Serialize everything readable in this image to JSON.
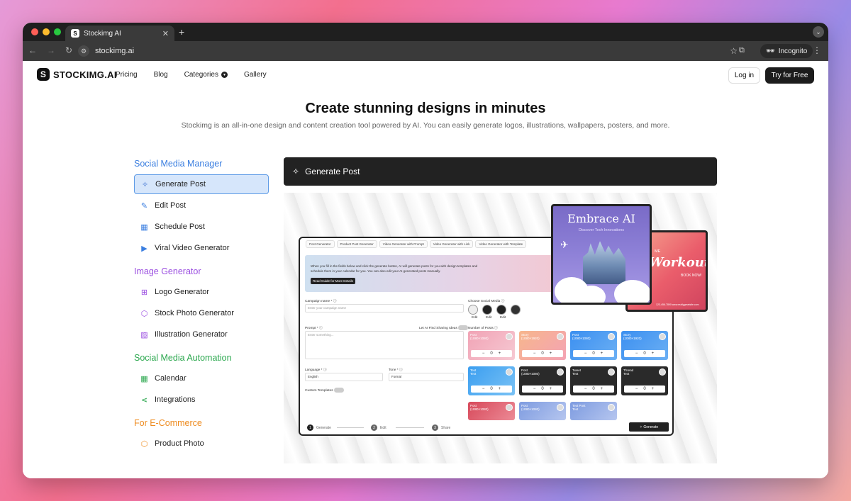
{
  "browser": {
    "tab_title": "Stockimg AI",
    "tab_favicon": "S",
    "url": "stockimg.ai",
    "incognito_label": "Incognito"
  },
  "nav": {
    "logo_text": "STOCKIMG.AI",
    "logo_mark": "S",
    "links": [
      "Pricing",
      "Blog",
      "Categories",
      "Gallery"
    ],
    "login": "Log in",
    "try_free": "Try for Free"
  },
  "hero": {
    "title": "Create stunning designs in minutes",
    "subtitle": "Stockimg is an all-in-one design and content creation tool powered by AI. You can easily generate logos, illustrations, wallpapers, posters, and more."
  },
  "sidebar": {
    "sections": [
      {
        "title": "Social Media Manager",
        "color": "#3a7ee0",
        "items": [
          {
            "label": "Generate Post",
            "icon": "sparkle-icon"
          },
          {
            "label": "Edit Post",
            "icon": "edit-icon"
          },
          {
            "label": "Schedule Post",
            "icon": "calendar-icon"
          },
          {
            "label": "Viral Video Generator",
            "icon": "video-icon"
          }
        ]
      },
      {
        "title": "Image Generator",
        "color": "#9b4fe0",
        "items": [
          {
            "label": "Logo Generator",
            "icon": "grid-icon"
          },
          {
            "label": "Stock Photo Generator",
            "icon": "cube-icon"
          },
          {
            "label": "Illustration Generator",
            "icon": "image-icon"
          }
        ]
      },
      {
        "title": "Social Media Automation",
        "color": "#2ca84f",
        "items": [
          {
            "label": "Calendar",
            "icon": "calendar-icon"
          },
          {
            "label": "Integrations",
            "icon": "share-icon"
          }
        ]
      },
      {
        "title": "For E-Commerce",
        "color": "#ee8b1f",
        "items": [
          {
            "label": "Product Photo",
            "icon": "box-icon"
          }
        ]
      }
    ]
  },
  "demo": {
    "header": "Generate Post",
    "mock": {
      "tabs": [
        "Post Generator",
        "Product Post Generator",
        "Video Generator with Prompt",
        "Video Generator with Link",
        "Video Generator with Template"
      ],
      "banner_text": "When you fill in the fields below and click the generate button, AI will generate posts for you with design templates and schedule them in your calendar for you. You can also edit your AI-generated posts manually.",
      "banner_button": "Read Guide for More Details",
      "campaign_label": "Campaign name * ⓘ",
      "campaign_placeholder": "Enter your campaign name",
      "social_label": "Choose Social Media ⓘ",
      "social_edit": [
        "Edit",
        "Edit",
        "Edit"
      ],
      "prompt_label": "Prompt * ⓘ",
      "prompt_placeholder": "Enter something...",
      "find_ideas": "Let AI Find Sharing Ideas",
      "num_posts_label": "Number of Posts ⓘ",
      "language_label": "Language * ⓘ",
      "language_value": "English",
      "tone_label": "Tone * ⓘ",
      "tone_value": "Formal",
      "custom_templates": "Custom Templates",
      "tiles": [
        {
          "name": "Post",
          "size": "(1080×1080)",
          "count": "0"
        },
        {
          "name": "Story",
          "size": "(1080×1920)",
          "count": "0"
        },
        {
          "name": "Post",
          "size": "(1080×1080)",
          "count": "0"
        },
        {
          "name": "Story",
          "size": "(1080×1920)",
          "count": "0"
        },
        {
          "name": "Text",
          "size": "Text",
          "count": "0"
        },
        {
          "name": "Post",
          "size": "(1080×1080)",
          "count": "0"
        },
        {
          "name": "Tweet",
          "size": "Text",
          "count": "0"
        },
        {
          "name": "Thread",
          "size": "Text",
          "count": "0"
        },
        {
          "name": "Post",
          "size": "(1080×1080)",
          "count": ""
        },
        {
          "name": "Post",
          "size": "(1080×1080)",
          "count": ""
        },
        {
          "name": "Text Post",
          "size": "Text",
          "count": ""
        }
      ],
      "steps": [
        "Generate",
        "Edit",
        "Share"
      ],
      "step_numbers": [
        "1",
        "2",
        "3"
      ],
      "generate_button": "Generate"
    },
    "poster1": {
      "title": "Embrace AI",
      "subtitle": "Discover Tech Innovations"
    },
    "poster2": {
      "me": "ME",
      "title": "Workout",
      "book": "BOOK NOW!",
      "footer": "123-456-7890  www.reallygreatsite.com"
    }
  }
}
